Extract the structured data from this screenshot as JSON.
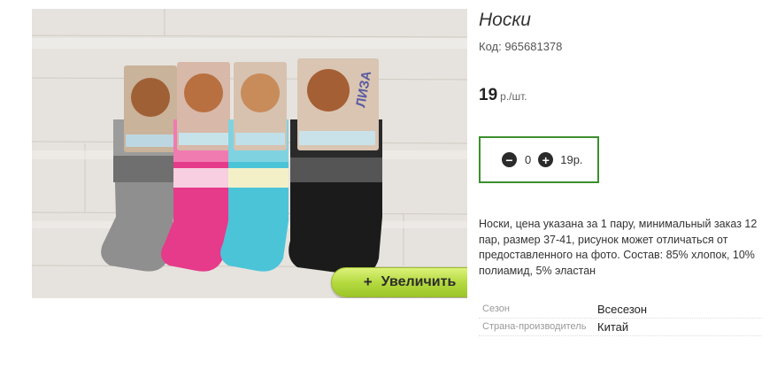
{
  "product": {
    "title": "Носки",
    "code": "Код: 965681378",
    "price_value": "19",
    "price_unit": "р./шт.",
    "description": "Носки, цена указана за 1 пару, минимальный заказ 12 пар, размер 37-41, рисунок может отличаться от предоставленного на фото. Состав: 85% хлопок, 10% полиамид, 5% эластан",
    "image_alt": "Носки"
  },
  "image": {
    "zoom_label": "Увеличить",
    "zoom_icon": "+",
    "brand_text": "ЛИЗА"
  },
  "quantity": {
    "minus_icon": "−",
    "plus_icon": "+",
    "value": "0",
    "total": "19р."
  },
  "properties": [
    {
      "key": "Сезон",
      "value": "Всесезон"
    },
    {
      "key": "Страна-производитель",
      "value": "Китай"
    }
  ],
  "colors": {
    "accent_border": "#3c8f2d",
    "zoom_button": "#b2d83c",
    "sock_colors": [
      "#8f8f8f",
      "#e63a8a",
      "#4cc4d8",
      "#1b1b1b"
    ]
  }
}
